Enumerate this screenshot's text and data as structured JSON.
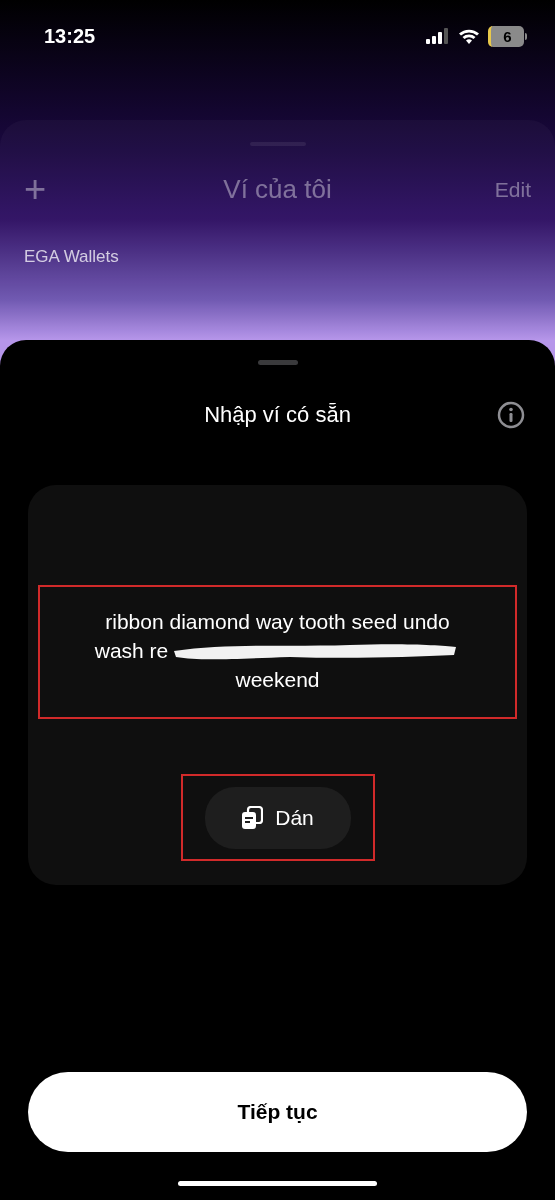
{
  "status_bar": {
    "time": "13:25",
    "battery": "6"
  },
  "background_screen": {
    "add": "+",
    "title": "Ví của tôi",
    "edit": "Edit",
    "section": "EGA Wallets"
  },
  "sheet": {
    "title": "Nhập ví có sẵn",
    "phrase_lines": [
      "ribbon diamond way tooth seed undo",
      "wash re",
      "weekend"
    ],
    "paste_button": "Dán",
    "continue_button": "Tiếp tục"
  }
}
